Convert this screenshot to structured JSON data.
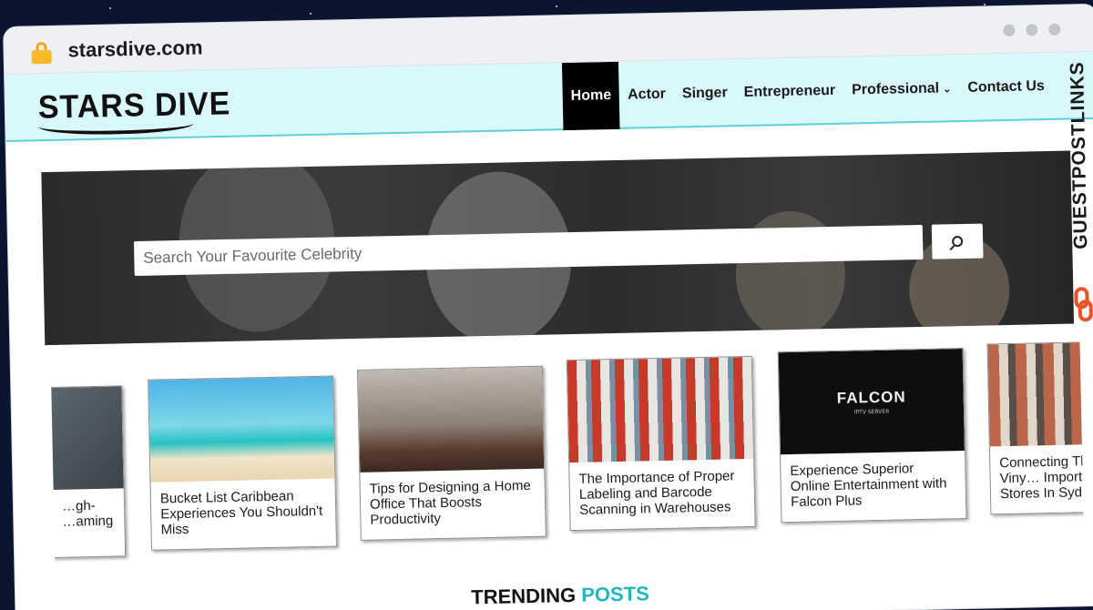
{
  "browser": {
    "url": "starsdive.com"
  },
  "header": {
    "logo": "STARS DIVE",
    "nav": [
      {
        "label": "Home",
        "active": true
      },
      {
        "label": "Actor"
      },
      {
        "label": "Singer"
      },
      {
        "label": "Entrepreneur"
      },
      {
        "label": "Professional"
      },
      {
        "label": "Contact Us"
      }
    ]
  },
  "hero": {
    "search_placeholder": "Search Your Favourite Celebrity"
  },
  "cards": [
    {
      "title": "…gh-\n…aming"
    },
    {
      "title": "Bucket List Caribbean Experiences You Shouldn't Miss"
    },
    {
      "title": "Tips for Designing a Home Office That Boosts Productivity"
    },
    {
      "title": "The Importance of Proper Labeling and Barcode Scanning in Warehouses"
    },
    {
      "title": "Experience Superior Online Entertainment with Falcon Plus",
      "thumb_text": "FALCON",
      "thumb_sub": "IPTV SERVER"
    },
    {
      "title": "Connecting Through Viny… Importance … Stores In Syd…"
    }
  ],
  "section": {
    "trending_a": "TRENDING",
    "trending_b": "POSTS"
  },
  "watermark": "GUESTPOSTLINKS",
  "colors": {
    "header_bg": "#d9f8fb",
    "accent": "#23b6bf",
    "active_nav": "#000000"
  }
}
